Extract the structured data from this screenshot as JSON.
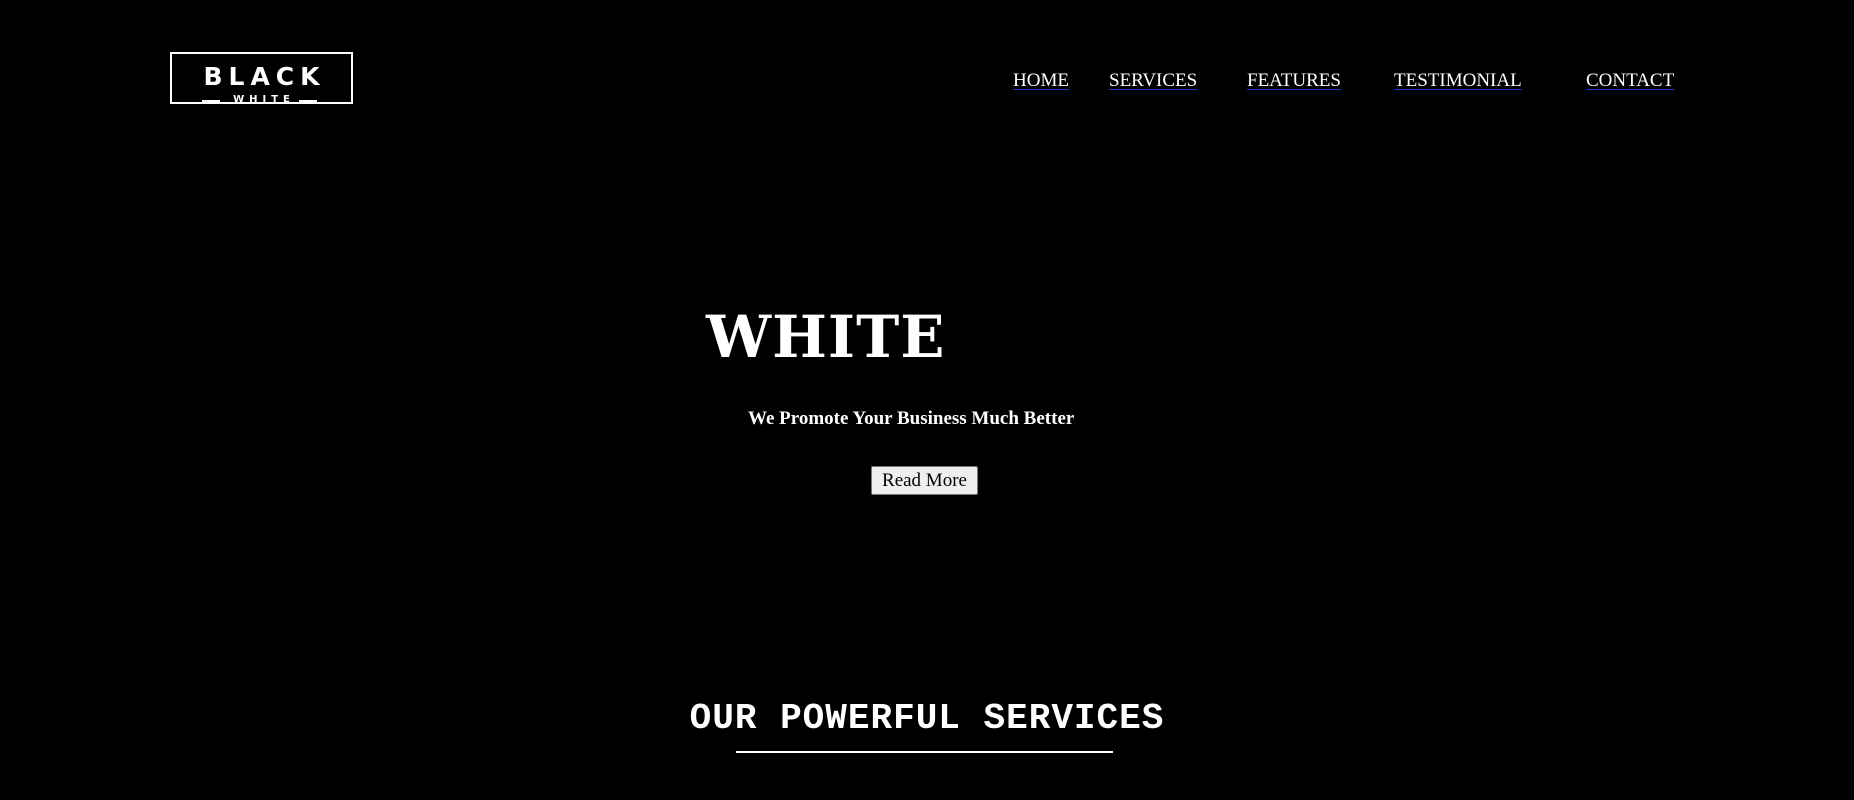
{
  "header": {
    "logo": {
      "main": "BLACK",
      "sub": "WHITE"
    },
    "nav": {
      "home": "HOME",
      "services": "SERVICES",
      "features": "FEATURES",
      "testimonial": "TESTIMONIAL",
      "contact": "CONTACT"
    }
  },
  "hero": {
    "title": "WHITE",
    "subtitle": "We Promote Your Business Much Better",
    "button_label": "Read More"
  },
  "services": {
    "heading": "OUR POWERFUL SERVICES"
  },
  "colors": {
    "background": "#000000",
    "text": "#ffffff",
    "link_underline": "#2a36c8",
    "button_bg": "#efefef"
  }
}
